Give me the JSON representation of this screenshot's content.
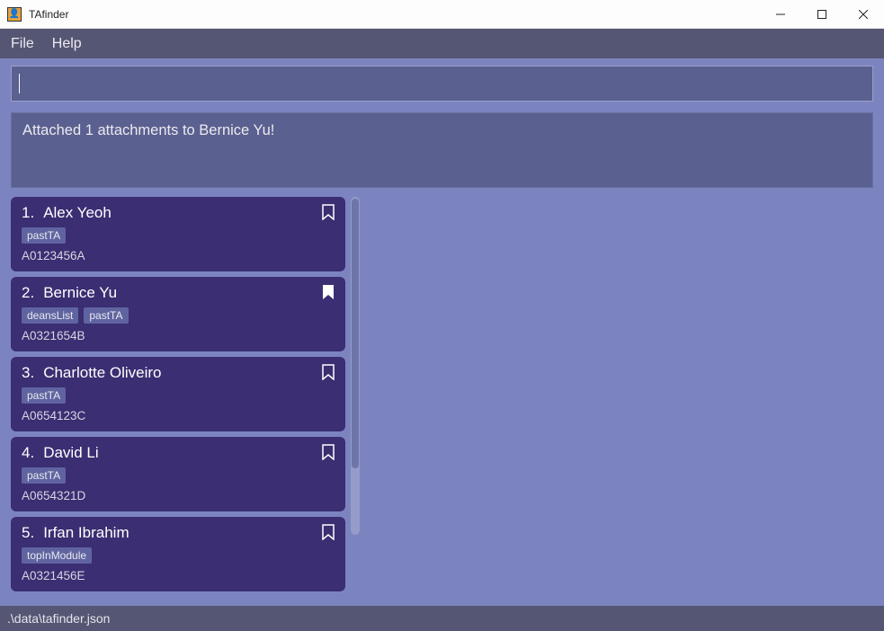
{
  "window": {
    "title": "TAfinder"
  },
  "menu": {
    "file": "File",
    "help": "Help"
  },
  "command": {
    "value": ""
  },
  "result": {
    "message": "Attached 1 attachments to Bernice Yu!"
  },
  "list": [
    {
      "index": "1.",
      "name": "Alex Yeoh",
      "tags": [
        "pastTA"
      ],
      "id": "A0123456A",
      "bookmarked": false
    },
    {
      "index": "2.",
      "name": "Bernice Yu",
      "tags": [
        "deansList",
        "pastTA"
      ],
      "id": "A0321654B",
      "bookmarked": true
    },
    {
      "index": "3.",
      "name": "Charlotte Oliveiro",
      "tags": [
        "pastTA"
      ],
      "id": "A0654123C",
      "bookmarked": false
    },
    {
      "index": "4.",
      "name": "David Li",
      "tags": [
        "pastTA"
      ],
      "id": "A0654321D",
      "bookmarked": false
    },
    {
      "index": "5.",
      "name": "Irfan Ibrahim",
      "tags": [
        "topInModule"
      ],
      "id": "A0321456E",
      "bookmarked": false
    }
  ],
  "statusbar": {
    "path": ".\\data\\tafinder.json"
  }
}
